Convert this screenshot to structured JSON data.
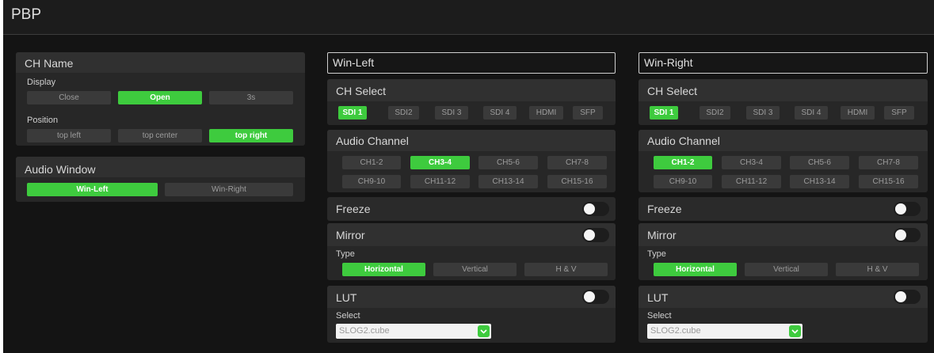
{
  "app": {
    "title": "PBP"
  },
  "colors": {
    "accent": "#3ecb3e",
    "panel": "#272727",
    "background": "#141414"
  },
  "ch_name": {
    "title": "CH Name",
    "display_label": "Display",
    "display_options": [
      "Close",
      "Open",
      "3s"
    ],
    "display_selected": "Open",
    "position_label": "Position",
    "position_options": [
      "top left",
      "top center",
      "top right"
    ],
    "position_selected": "top right"
  },
  "audio_window": {
    "title": "Audio Window",
    "options": [
      "Win-Left",
      "Win-Right"
    ],
    "selected": "Win-Left"
  },
  "win_left": {
    "title": "Win-Left",
    "ch_select_label": "CH Select",
    "ch_options": [
      "SDI 1",
      "SDI2",
      "SDI 3",
      "SDI 4",
      "HDMI",
      "SFP"
    ],
    "ch_selected": "SDI 1",
    "audio_channel_label": "Audio Channel",
    "audio_options": [
      "CH1-2",
      "CH3-4",
      "CH5-6",
      "CH7-8",
      "CH9-10",
      "CH11-12",
      "CH13-14",
      "CH15-16"
    ],
    "audio_selected": "CH3-4",
    "freeze_label": "Freeze",
    "freeze_on": false,
    "mirror_label": "Mirror",
    "mirror_on": false,
    "type_label": "Type",
    "type_options": [
      "Horizontal",
      "Vertical",
      "H & V"
    ],
    "type_selected": "Horizontal",
    "lut_label": "LUT",
    "lut_on": false,
    "select_label": "Select",
    "lut_value": "SLOG2.cube"
  },
  "win_right": {
    "title": "Win-Right",
    "ch_select_label": "CH Select",
    "ch_options": [
      "SDI 1",
      "SDI2",
      "SDI 3",
      "SDI 4",
      "HDMI",
      "SFP"
    ],
    "ch_selected": "SDI 1",
    "audio_channel_label": "Audio Channel",
    "audio_options": [
      "CH1-2",
      "CH3-4",
      "CH5-6",
      "CH7-8",
      "CH9-10",
      "CH11-12",
      "CH13-14",
      "CH15-16"
    ],
    "audio_selected": "CH1-2",
    "freeze_label": "Freeze",
    "freeze_on": false,
    "mirror_label": "Mirror",
    "mirror_on": false,
    "type_label": "Type",
    "type_options": [
      "Horizontal",
      "Vertical",
      "H & V"
    ],
    "type_selected": "Horizontal",
    "lut_label": "LUT",
    "lut_on": false,
    "select_label": "Select",
    "lut_value": "SLOG2.cube"
  }
}
